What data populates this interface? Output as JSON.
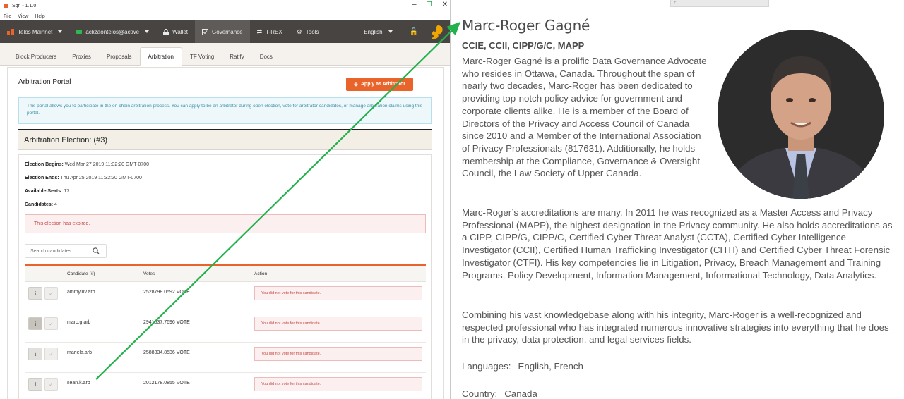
{
  "app": {
    "window_title": "Sqrl - 1.1.0",
    "menu": [
      "File",
      "View",
      "Help"
    ],
    "nav": {
      "network": "Telos Mainnet",
      "account": "ackzaontelos@active",
      "wallet": "Wallet",
      "governance": "Governance",
      "trex": "T-REX",
      "tools": "Tools",
      "language": "English"
    },
    "tabs": [
      "Block Producers",
      "Proxies",
      "Proposals",
      "Arbitration",
      "TF Voting",
      "Ratify",
      "Docs"
    ],
    "active_tab": "Arbitration",
    "portal": {
      "title": "Arbitration Portal",
      "apply_button": "Apply as Arbitrator",
      "info": "This portal allows you to participate in the on-chain arbitration process. You can apply to be an arbitrator during open election, vote for arbitrator candidates, or manage arbitration claims using this portal."
    },
    "election": {
      "heading": "Arbitration Election: (#3)",
      "begins_label": "Election Begins:",
      "begins_value": "Wed Mar 27 2019 11:32:20 GMT-0700",
      "ends_label": "Election Ends:",
      "ends_value": "Thu Apr 25 2019 11:32:20 GMT-0700",
      "seats_label": "Available Seats:",
      "seats_value": "17",
      "candidates_label": "Candidates:",
      "candidates_value": "4",
      "expired_notice": "This election has expired."
    },
    "search": {
      "placeholder": "Search candidates..."
    },
    "table": {
      "headers": {
        "candidate": "Candidate (#)",
        "votes": "Votes",
        "action": "Action"
      },
      "rows": [
        {
          "name": "ammyluv.arb",
          "votes": "2528798.0592 VOTE",
          "status": "You did not vote for this candidate."
        },
        {
          "name": "marc.g.arb",
          "votes": "2941537.7696 VOTE",
          "status": "You did not vote for this candidate."
        },
        {
          "name": "mariela.arb",
          "votes": "2588834.8536 VOTE",
          "status": "You did not vote for this candidate."
        },
        {
          "name": "sean.k.arb",
          "votes": "2012178.0855 VOTE",
          "status": "You did not vote for this candidate."
        }
      ]
    },
    "colors": {
      "accent": "#e8642b",
      "navbar": "#474442",
      "arrow": "#22b14c"
    }
  },
  "bio": {
    "name": "Marc-Roger Gagné",
    "credentials": "CCIE, CCII, CIPP/G/C, MAPP",
    "paragraph_1": "Marc-Roger Gagné is a prolific Data Governance Advocate who resides in Ottawa, Canada. Throughout the span of nearly two decades, Marc-Roger has been dedicated to providing top-notch policy advice for government and corporate clients alike. He is a member of the Board of Directors of the Privacy and Access Council of Canada since 2010 and a Member of the International Association of Privacy Professionals (817631). Additionally, he holds membership at the Compliance, Governance & Oversight Council, the Law Society of Upper Canada.",
    "paragraph_2": "Marc-Roger’s accreditations are many. In 2011 he was recognized as a Master Access and Privacy Professional (MAPP), the highest designation in the Privacy community. He also holds accreditations as a CIPP, CIPP/G, CIPP/C, Certified Cyber Threat Analyst (CCTA), Certified Cyber Intelligence Investigator (CCII), Certified Human Trafficking Investigator (CHTI) and Certified Cyber Threat Forensic Investigator (CTFI). His key competencies lie in Litigation, Privacy, Breach Management and Training Programs, Policy Development, Information Management, Informational Technology, Data Analytics.",
    "paragraph_3": "Combining his vast knowledgebase along with his integrity, Marc-Roger is a well-recognized and respected professional who has integrated numerous innovative strategies into everything that he does in the privacy, data protection, and legal services fields.",
    "languages_label": "Languages:",
    "languages_value": "English, French",
    "country_label": "Country:",
    "country_value": "Canada"
  }
}
